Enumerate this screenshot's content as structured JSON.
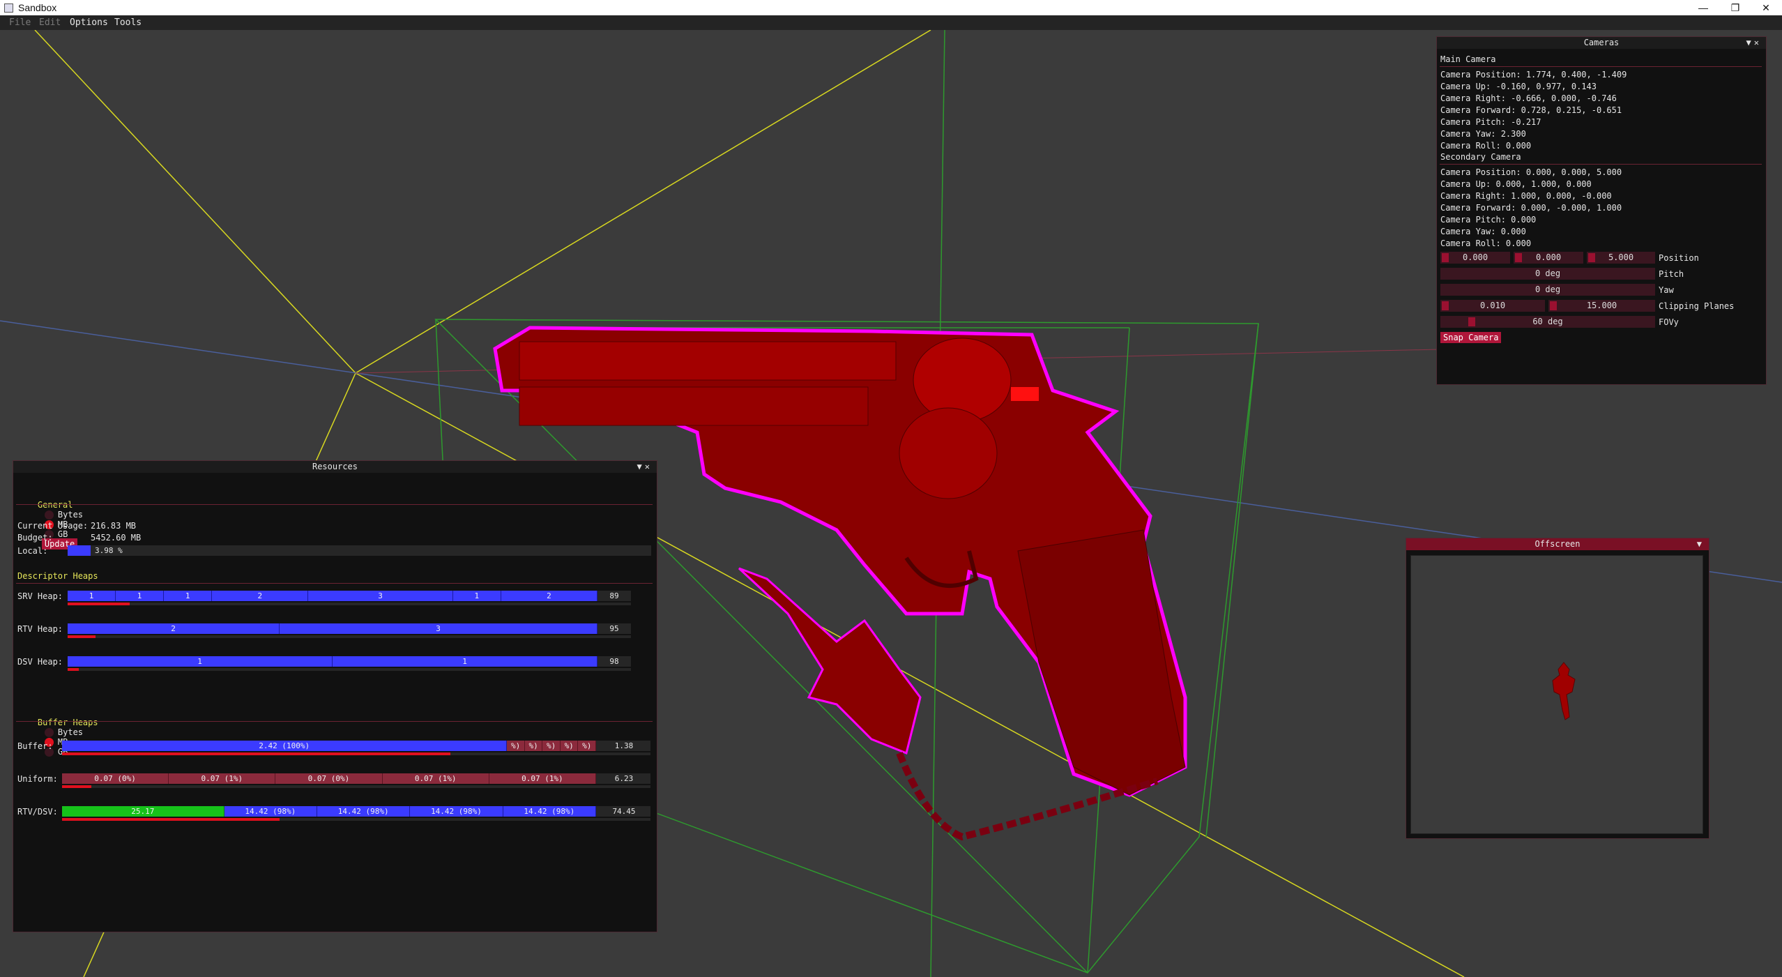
{
  "window": {
    "title": "Sandbox",
    "controls": [
      "—",
      "❐",
      "✕"
    ]
  },
  "menu": [
    "File",
    "Edit",
    "Options",
    "Tools"
  ],
  "resources": {
    "title": "Resources",
    "general_label": "General",
    "units": [
      "Bytes",
      "MB",
      "GB"
    ],
    "selected_unit": "MB",
    "update_label": "Update",
    "current_usage_label": "Current Usage:",
    "current_usage": "216.83 MB",
    "budget_label": "Budget:",
    "budget": "5452.60 MB",
    "local_label": "Local:",
    "local_value": "3.98 %",
    "local_fraction": 0.0398,
    "descriptor_heaps_label": "Descriptor Heaps",
    "heaps": [
      {
        "label": "SRV Heap:",
        "segments": [
          "1",
          "1",
          "1",
          "2",
          "3",
          "1",
          "2"
        ],
        "weights": [
          1,
          1,
          1,
          2,
          3,
          1,
          2
        ],
        "remaining": "89",
        "used_fraction": 0.11
      },
      {
        "label": "RTV Heap:",
        "segments": [
          "2",
          "3"
        ],
        "weights": [
          2,
          3
        ],
        "remaining": "95",
        "used_fraction": 0.05
      },
      {
        "label": "DSV Heap:",
        "segments": [
          "1",
          "1"
        ],
        "weights": [
          1,
          1
        ],
        "remaining": "98",
        "used_fraction": 0.02
      }
    ],
    "buffer_heaps_label": "Buffer Heaps",
    "buffers": [
      {
        "label": "Buffer:",
        "style": "blue",
        "segments": [
          "2.42 (100%)",
          "%)",
          "%)",
          "%)",
          "%)",
          "%)"
        ],
        "weights": [
          25,
          1,
          1,
          1,
          1,
          1
        ],
        "remaining": "1.38",
        "used_fraction": 0.66
      },
      {
        "label": "Uniform:",
        "style": "pink",
        "segments": [
          "0.07 (0%)",
          "0.07 (1%)",
          "0.07 (0%)",
          "0.07 (1%)",
          "0.07 (1%)"
        ],
        "weights": [
          1,
          1,
          1,
          1,
          1
        ],
        "remaining": "6.23",
        "used_fraction": 0.05
      },
      {
        "label": "RTV/DSV:",
        "style": "mixed",
        "segments": [
          "25.17",
          "14.42 (98%)",
          "14.42 (98%)",
          "14.42 (98%)",
          "14.42 (98%)"
        ],
        "weights": [
          25.17,
          14.42,
          14.42,
          14.42,
          14.42
        ],
        "remaining": "74.45",
        "used_fraction": 0.37
      }
    ]
  },
  "cameras": {
    "title": "Cameras",
    "main_label": "Main Camera",
    "main": [
      "Camera Position: 1.774, 0.400, -1.409",
      "Camera Up: -0.160, 0.977, 0.143",
      "Camera Right: -0.666, 0.000, -0.746",
      "Camera Forward: 0.728, 0.215, -0.651",
      "Camera Pitch: -0.217",
      "Camera Yaw: 2.300",
      "Camera Roll: 0.000"
    ],
    "secondary_label": "Secondary Camera",
    "secondary": [
      "Camera Position: 0.000, 0.000, 5.000",
      "Camera Up: 0.000, 1.000, 0.000",
      "Camera Right: 1.000, 0.000, -0.000",
      "Camera Forward: 0.000, -0.000, 1.000",
      "Camera Pitch: 0.000",
      "Camera Yaw: 0.000",
      "Camera Roll: 0.000"
    ],
    "position_values": [
      "0.000",
      "0.000",
      "5.000"
    ],
    "position_label": "Position",
    "pitch_value": "0 deg",
    "pitch_label": "Pitch",
    "yaw_value": "0 deg",
    "yaw_label": "Yaw",
    "clip_values": [
      "0.010",
      "15.000"
    ],
    "clip_label": "Clipping Planes",
    "fov_value": "60 deg",
    "fov_label": "FOVy",
    "snap_label": "Snap Camera"
  },
  "offscreen": {
    "title": "Offscreen"
  },
  "colors": {
    "accent": "#b0163a",
    "heap_bar": "#3b3bff",
    "used": "#e0101e",
    "model": "#8a0000",
    "outline": "#ff00ff"
  }
}
